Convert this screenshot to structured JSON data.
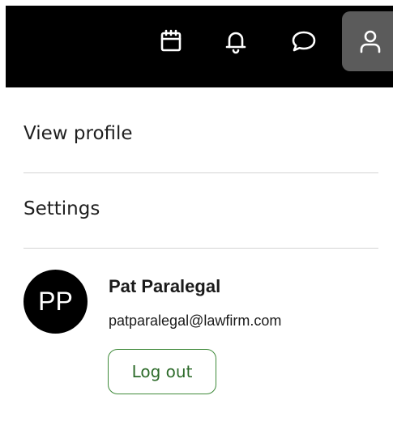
{
  "topbar": {
    "icons": [
      "calendar-icon",
      "bell-icon",
      "chat-icon",
      "user-icon"
    ],
    "active_icon_bg": "#5b5b5b"
  },
  "menu": {
    "view_profile": "View profile",
    "settings": "Settings"
  },
  "user": {
    "initials": "PP",
    "name": "Pat Paralegal",
    "email": "patparalegal@lawfirm.com"
  },
  "actions": {
    "logout": "Log out"
  },
  "colors": {
    "accent": "#3f8a3a"
  }
}
